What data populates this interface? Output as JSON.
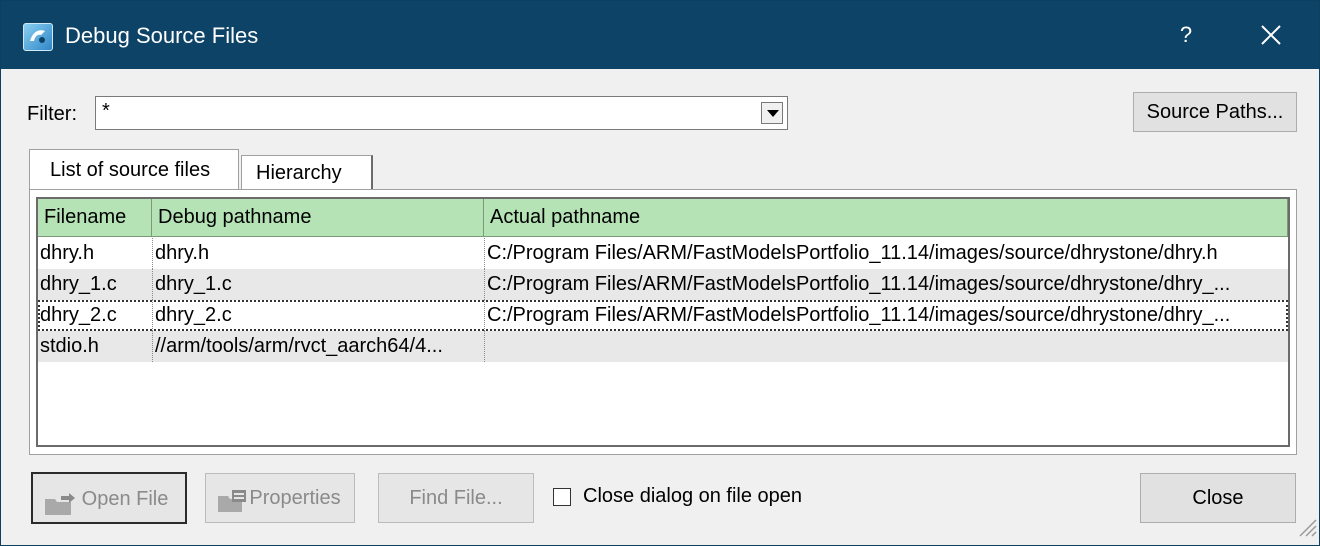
{
  "window": {
    "title": "Debug Source Files",
    "help_label": "?",
    "icons": {
      "app": "dialog-app-icon",
      "close": "close-icon"
    }
  },
  "filter": {
    "label": "Filter:",
    "value": "*"
  },
  "source_paths_label": "Source Paths...",
  "tabs": [
    {
      "label": "List of source files",
      "active": true
    },
    {
      "label": "Hierarchy",
      "active": false
    }
  ],
  "table": {
    "columns": [
      "Filename",
      "Debug pathname",
      "Actual pathname"
    ],
    "rows": [
      {
        "filename": "dhry.h",
        "debug": "dhry.h",
        "actual": "C:/Program Files/ARM/FastModelsPortfolio_11.14/images/source/dhrystone/dhry.h"
      },
      {
        "filename": "dhry_1.c",
        "debug": "dhry_1.c",
        "actual": "C:/Program Files/ARM/FastModelsPortfolio_11.14/images/source/dhrystone/dhry_..."
      },
      {
        "filename": "dhry_2.c",
        "debug": "dhry_2.c",
        "actual": "C:/Program Files/ARM/FastModelsPortfolio_11.14/images/source/dhrystone/dhry_..."
      },
      {
        "filename": "stdio.h",
        "debug": "//arm/tools/arm/rvct_aarch64/4...",
        "actual": ""
      }
    ],
    "header_color": "#b5e3b5"
  },
  "buttons": {
    "open_file": "Open File",
    "properties": "Properties",
    "find_file": "Find File...",
    "close": "Close"
  },
  "close_on_open": {
    "label": "Close dialog on file open",
    "checked": false
  },
  "colors": {
    "titlebar": "#0e4368",
    "dialog_bg": "#f0f0f0"
  }
}
